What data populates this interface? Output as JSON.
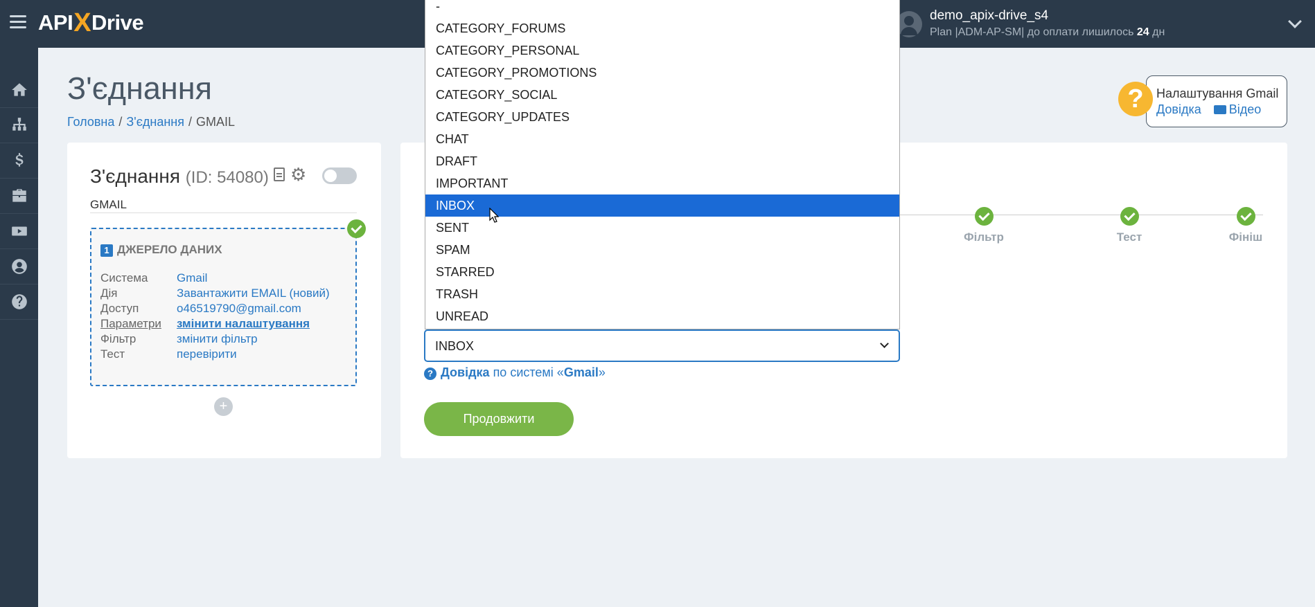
{
  "topbar": {
    "logo_left": "API",
    "logo_x": "X",
    "logo_right": "Drive",
    "user_name": "demo_apix-drive_s4",
    "plan_prefix": "Plan |ADM-AP-SM| до оплати лишилось ",
    "plan_days": "24",
    "plan_suffix": " дн"
  },
  "sidebar": {
    "items": [
      "home-icon",
      "sitemap-icon",
      "dollar-icon",
      "briefcase-icon",
      "youtube-icon",
      "user-icon",
      "help-icon"
    ]
  },
  "page": {
    "title": "З'єднання",
    "breadcrumb": [
      "Головна",
      "З'єднання",
      "GMAIL"
    ]
  },
  "help": {
    "title": "Налаштування Gmail",
    "link_help": "Довідка",
    "link_video": "Відео"
  },
  "connection": {
    "title": "З'єднання",
    "id": "(ID: 54080)",
    "name": "GMAIL",
    "source_num": "1",
    "source_title": "ДЖЕРЕЛО ДАНИХ",
    "rows": [
      {
        "key": "Система",
        "value": "Gmail"
      },
      {
        "key": "Дія",
        "value": "Завантажити EMAIL (новий)"
      },
      {
        "key": "Доступ",
        "value": "o46519790@gmail.com"
      },
      {
        "key": "Параметри",
        "value": "змінити налаштування"
      },
      {
        "key": "Фільтр",
        "value": "змінити фільтр"
      },
      {
        "key": "Тест",
        "value": "перевірити"
      }
    ],
    "add_label": "+"
  },
  "steps": [
    "Фільтр",
    "Тест",
    "Фініш"
  ],
  "select": {
    "value": "INBOX"
  },
  "help_line": {
    "bold": "Довідка",
    "middle": " по системі «",
    "system": "Gmail",
    "end": "»"
  },
  "continue_label": "Продовжити",
  "dropdown": {
    "options": [
      "-",
      "CATEGORY_FORUMS",
      "CATEGORY_PERSONAL",
      "CATEGORY_PROMOTIONS",
      "CATEGORY_SOCIAL",
      "CATEGORY_UPDATES",
      "CHAT",
      "DRAFT",
      "IMPORTANT",
      "INBOX",
      "SENT",
      "SPAM",
      "STARRED",
      "TRASH",
      "UNREAD"
    ],
    "selected_index": 9
  },
  "colors": {
    "topbar": "#2b3a4a",
    "accent": "#2a79c4",
    "success": "#6cb33e",
    "button": "#7ab648",
    "highlight": "#1a6ad6"
  }
}
